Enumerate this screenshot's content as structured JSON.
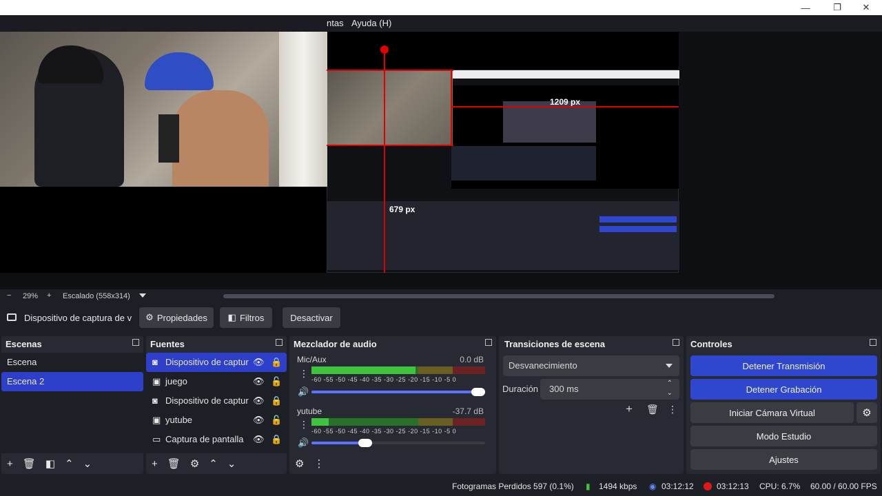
{
  "menu": {
    "item1_label": "ntas",
    "help_label": "Ayuda (H)"
  },
  "window": {
    "minimize_icon": "—",
    "restore_icon": "❐",
    "close_icon": "✕"
  },
  "preview": {
    "nested_px_label_1": "1209 px",
    "nested_px_label_2": "679 px"
  },
  "zoom": {
    "minus": "−",
    "percent": "29%",
    "plus": "+",
    "scaling": "Escalado (558x314)"
  },
  "source_toolbar": {
    "source_name": "Dispositivo de captura de v",
    "properties_label": "Propiedades",
    "filters_label": "Filtros",
    "deactivate_label": "Desactivar"
  },
  "scenes": {
    "title": "Escenas",
    "items": [
      {
        "label": "Escena",
        "selected": false
      },
      {
        "label": "Escena 2",
        "selected": true
      }
    ]
  },
  "sources": {
    "title": "Fuentes",
    "items": [
      {
        "label": "Dispositivo de captur",
        "icon": "camera-icon",
        "selected": true
      },
      {
        "label": "juego",
        "icon": "game-capture-icon",
        "selected": false
      },
      {
        "label": "Dispositivo de captur",
        "icon": "camera-icon",
        "selected": false
      },
      {
        "label": "yutube",
        "icon": "game-capture-icon",
        "selected": false
      },
      {
        "label": "Captura de pantalla",
        "icon": "monitor-icon",
        "selected": false
      }
    ]
  },
  "mixer": {
    "title": "Mezclador de audio",
    "channels": [
      {
        "name": "Mic/Aux",
        "db": "0.0 dB",
        "level": 0.6,
        "volume": 1.0
      },
      {
        "name": "yutube",
        "db": "-37.7 dB",
        "level": 0.1,
        "volume": 0.31
      }
    ],
    "scale": [
      "-60",
      "-55",
      "-50",
      "-45",
      "-40",
      "-35",
      "-30",
      "-25",
      "-20",
      "-15",
      "-10",
      "-5",
      "0"
    ]
  },
  "transitions": {
    "title": "Transiciones de escena",
    "type": "Desvanecimiento",
    "duration_label": "Duración",
    "duration_value": "300 ms"
  },
  "controls": {
    "title": "Controles",
    "stop_stream": "Detener Transmisión",
    "stop_record": "Detener Grabación",
    "virtual_cam": "Iniciar Cámara Virtual",
    "studio_mode": "Modo Estudio",
    "settings": "Ajustes"
  },
  "status": {
    "dropped_frames": "Fotogramas Perdidos 597 (0.1%)",
    "bitrate": "1494 kbps",
    "stream_time": "03:12:12",
    "record_time": "03:12:13",
    "cpu": "CPU: 6.7%",
    "fps": "60.00 / 60.00 FPS"
  },
  "colors": {
    "accent_blue": "#2f46cf",
    "meter_green": "#3fc43f",
    "meter_yellow": "#c9b12b",
    "meter_red": "#c42b2b",
    "record_red": "#e01818"
  }
}
